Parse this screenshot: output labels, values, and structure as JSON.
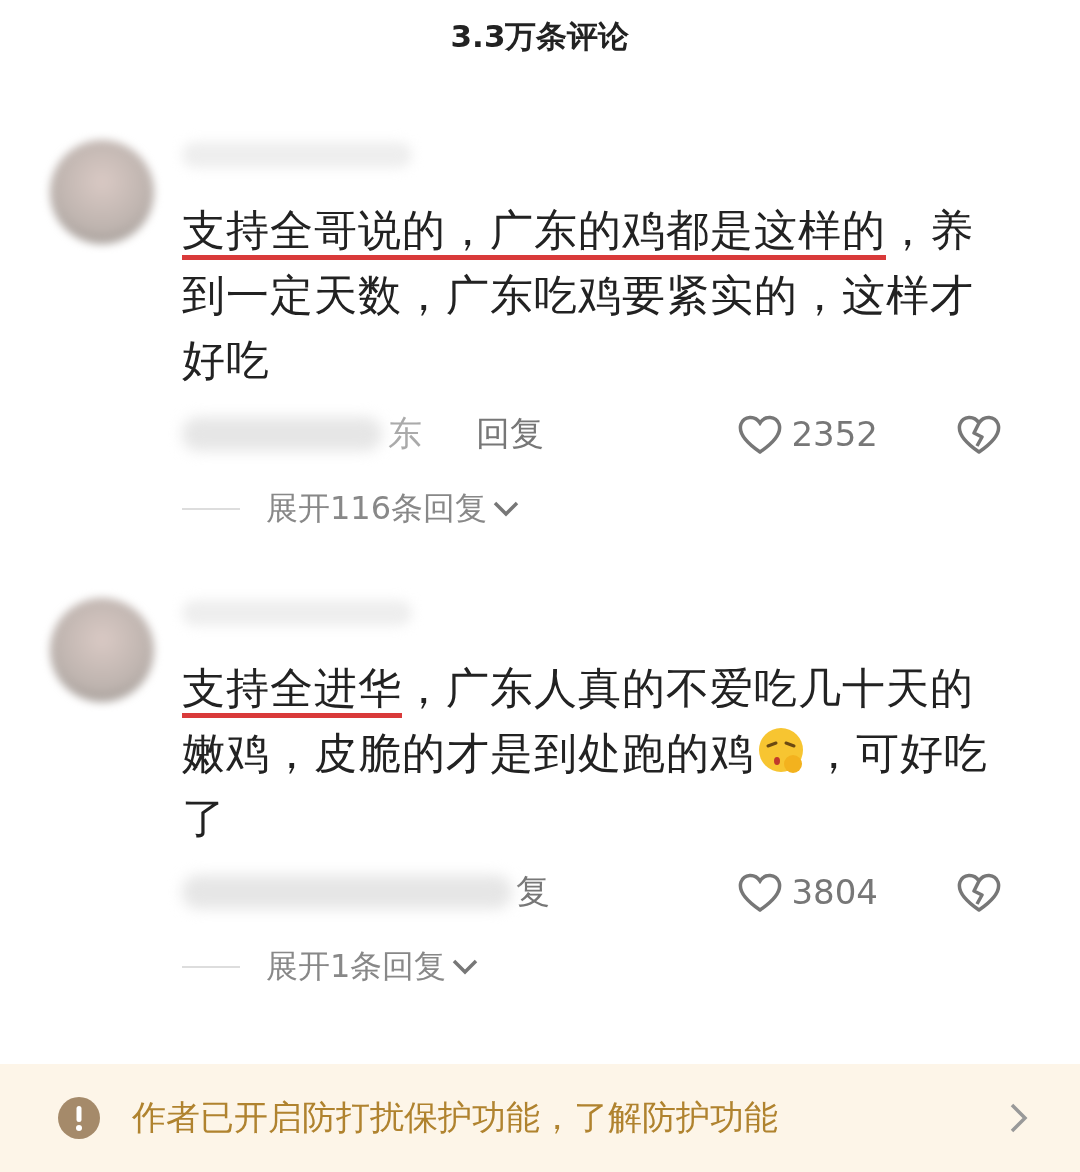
{
  "title": "3.3万条评论",
  "comments": [
    {
      "segments": [
        {
          "kind": "highlight",
          "text": "支持全哥说的，广东的鸡都是这样的"
        },
        {
          "kind": "text",
          "text": "，养到一定天数，广东吃鸡要紧实的，这样才好吃"
        }
      ],
      "location": "东",
      "reply": "回复",
      "likes": "2352",
      "expand": "展开116条回复"
    },
    {
      "segments": [
        {
          "kind": "highlight",
          "text": "支持全进华"
        },
        {
          "kind": "text",
          "text": "，广东人真的不爱吃几十天的嫩鸡，皮脆的才是到处跑的鸡"
        },
        {
          "kind": "emoji"
        },
        {
          "kind": "text",
          "text": "，可好吃了"
        }
      ],
      "reply": "复",
      "likes": "3804",
      "expand": "展开1条回复"
    }
  ],
  "notice": {
    "text": "作者已开启防打扰保护功能，了解防护功能"
  }
}
